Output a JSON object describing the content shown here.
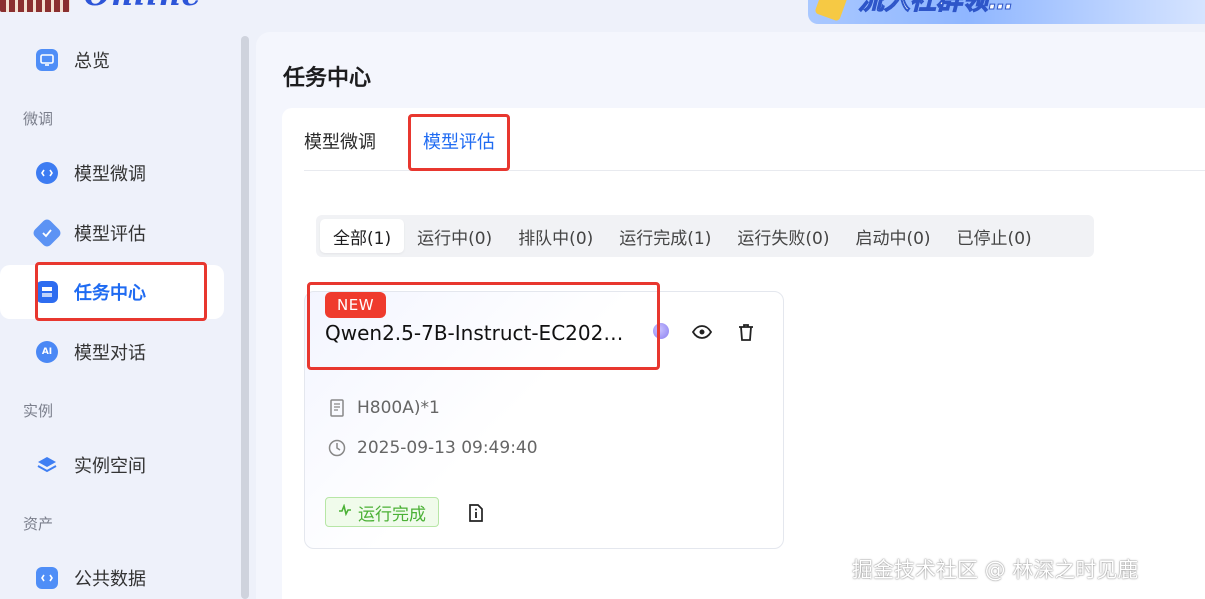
{
  "header": {
    "logo_text": "Online",
    "promo_text": "流入社群领…"
  },
  "sidebar": {
    "items": [
      {
        "label": "总览"
      },
      {
        "label": "模型微调"
      },
      {
        "label": "模型评估"
      },
      {
        "label": "任务中心"
      },
      {
        "label": "模型对话"
      },
      {
        "label": "实例空间"
      },
      {
        "label": "公共数据"
      }
    ],
    "groups": {
      "finetune": "微调",
      "instance": "实例",
      "assets": "资产"
    },
    "active_index": 3
  },
  "page": {
    "title": "任务中心",
    "tabs": [
      {
        "label": "模型微调"
      },
      {
        "label": "模型评估"
      }
    ],
    "active_tab": 1,
    "filters": [
      {
        "label": "全部(1)"
      },
      {
        "label": "运行中(0)"
      },
      {
        "label": "排队中(0)"
      },
      {
        "label": "运行完成(1)"
      },
      {
        "label": "运行失败(0)"
      },
      {
        "label": "启动中(0)"
      },
      {
        "label": "已停止(0)"
      }
    ],
    "active_filter": 0
  },
  "task": {
    "badge": "NEW",
    "name": "Qwen2.5-7B-Instruct-EC2025...",
    "resource": "H800A)*1",
    "created_at": "2025-09-13 09:49:40",
    "status": "运行完成"
  },
  "watermark": "掘金技术社区 @ 林深之时见鹿",
  "colors": {
    "accent": "#1f6bf2",
    "highlight_border": "#e8372f",
    "badge_red": "#ef3b2d",
    "success_green": "#4bb136"
  }
}
